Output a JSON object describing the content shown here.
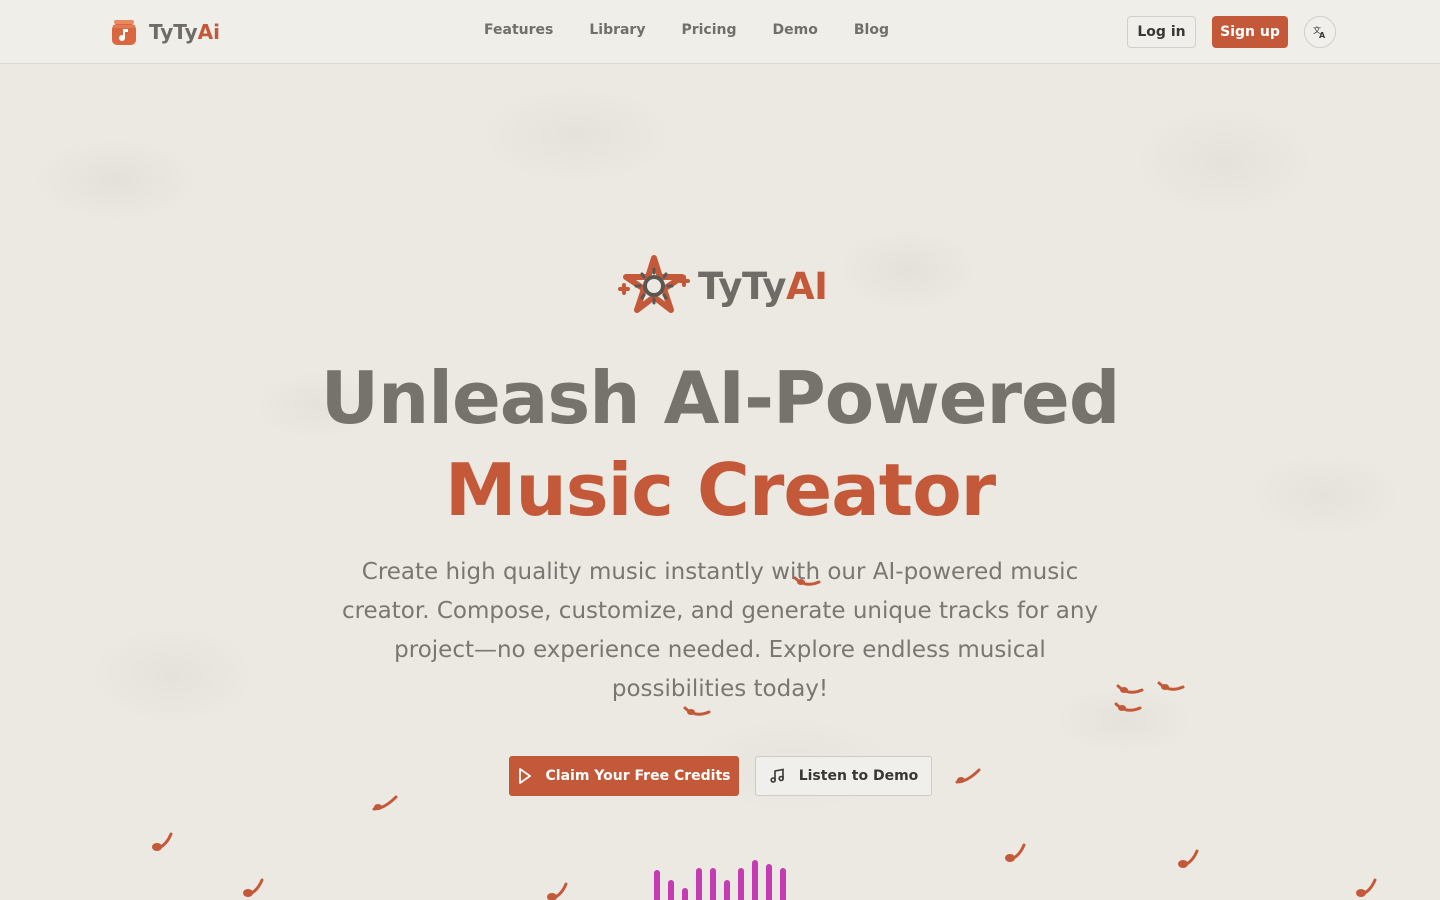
{
  "brand": {
    "name_prefix": "TyTy",
    "name_accent": "Ai"
  },
  "nav": {
    "items": [
      {
        "label": "Features"
      },
      {
        "label": "Library"
      },
      {
        "label": "Pricing"
      },
      {
        "label": "Demo"
      },
      {
        "label": "Blog"
      }
    ]
  },
  "header": {
    "login_label": "Log in",
    "signup_label": "Sign up",
    "language_icon": "translate-icon"
  },
  "hero": {
    "logo_prefix": "TyTy",
    "logo_accent": "AI",
    "headline_line1": "Unleash AI-Powered",
    "headline_line2": "Music Creator",
    "subtitle": "Create high quality music instantly with our AI-powered music creator. Compose, customize, and generate unique tracks for any project—no experience needed. Explore endless musical possibilities today!",
    "cta_primary": "Claim Your Free Credits",
    "cta_secondary": "Listen to Demo"
  },
  "colors": {
    "accent": "#c4593a",
    "text": "#6f6b66",
    "background": "#ece9e3",
    "equalizer": "#c43bb2"
  }
}
